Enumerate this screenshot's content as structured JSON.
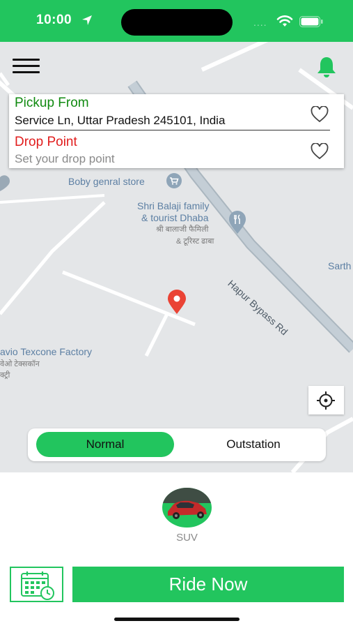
{
  "status_bar": {
    "time": "10:00",
    "dots": "....",
    "background_color": "#22c55e"
  },
  "header": {
    "menu_icon": "hamburger-menu-icon",
    "bell_icon": "bell-icon"
  },
  "location_card": {
    "pickup_label": "Pickup From",
    "pickup_value": "Service Ln, Uttar Pradesh 245101, India",
    "drop_label": "Drop Point",
    "drop_placeholder": "Set your drop point",
    "pickup_color": "#108a10",
    "drop_color": "#e11d1d"
  },
  "map": {
    "labels": {
      "store": "Boby genral store",
      "dhaba_line1": "Shri Balaji family",
      "dhaba_line2": "& tourist Dhaba",
      "dhaba_hindi_line1": "श्री बालाजी फैमिली",
      "dhaba_hindi_line2": "& टूरिस्ट ढाबा",
      "road": "Hapur Bypass Rd",
      "sarth": "Sarth",
      "factory_line1": "avio Texcone Factory",
      "factory_hindi_line1": "वेओ टेक्सकॉन",
      "factory_hindi_line2": "क्ट्री"
    },
    "marker_color": "#ea4335"
  },
  "mode_toggle": {
    "normal_label": "Normal",
    "outstation_label": "Outstation",
    "selected": "Normal"
  },
  "vehicle": {
    "label": "SUV"
  },
  "actions": {
    "ride_now_label": "Ride Now",
    "schedule_icon": "calendar-clock-icon"
  },
  "accent_color": "#22c55e"
}
